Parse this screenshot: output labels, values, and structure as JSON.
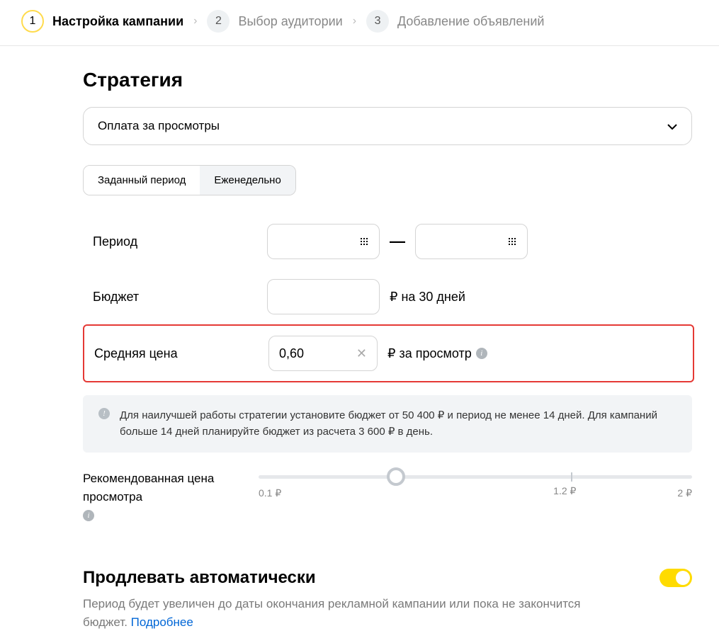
{
  "stepper": {
    "steps": [
      {
        "num": "1",
        "label": "Настройка кампании",
        "active": true
      },
      {
        "num": "2",
        "label": "Выбор аудитории",
        "active": false
      },
      {
        "num": "3",
        "label": "Добавление объявлений",
        "active": false
      }
    ]
  },
  "strategy": {
    "title": "Стратегия",
    "select_value": "Оплата за просмотры",
    "tabs": {
      "set_period": "Заданный период",
      "weekly": "Еженедельно"
    },
    "period": {
      "label": "Период",
      "dash": "—"
    },
    "budget": {
      "label": "Бюджет",
      "suffix": "₽ на 30 дней"
    },
    "avg_price": {
      "label": "Средняя цена",
      "value": "0,60",
      "suffix": "₽ за просмотр"
    },
    "notice": "Для наилучшей работы стратегии установите бюджет от 50 400 ₽ и период не менее 14 дней. Для кампаний больше 14 дней планируйте бюджет из расчета 3 600 ₽ в день.",
    "slider": {
      "label": "Рекомендованная цена просмотра",
      "min": "0.1 ₽",
      "mid": "1.2 ₽",
      "max": "2 ₽"
    }
  },
  "auto": {
    "title": "Продлевать автоматически",
    "desc": "Период будет увеличен до даты окончания рекламной кампании или пока не закончится бюджет. ",
    "link": "Подробнее"
  }
}
